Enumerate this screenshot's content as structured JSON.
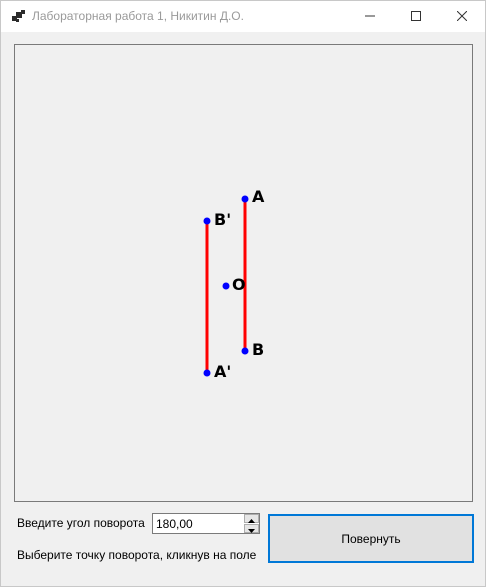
{
  "window": {
    "title": "Лабораторная работа 1, Никитин Д.О.",
    "icon": "app-window-icon",
    "controls": [
      "minimize-icon",
      "maximize-icon",
      "close-icon"
    ]
  },
  "canvas": {
    "points": {
      "A": "A",
      "B": "B",
      "A_prime": "A'",
      "B_prime": "B'",
      "O": "O"
    },
    "colors": {
      "segment": "#ff0000",
      "point": "#0000ff"
    }
  },
  "controls": {
    "angle_label": "Введите угол поворота",
    "angle_value": "180,00",
    "hint_label": "Выберите точку поворота, кликнув на поле",
    "rotate_button": "Повернуть"
  }
}
